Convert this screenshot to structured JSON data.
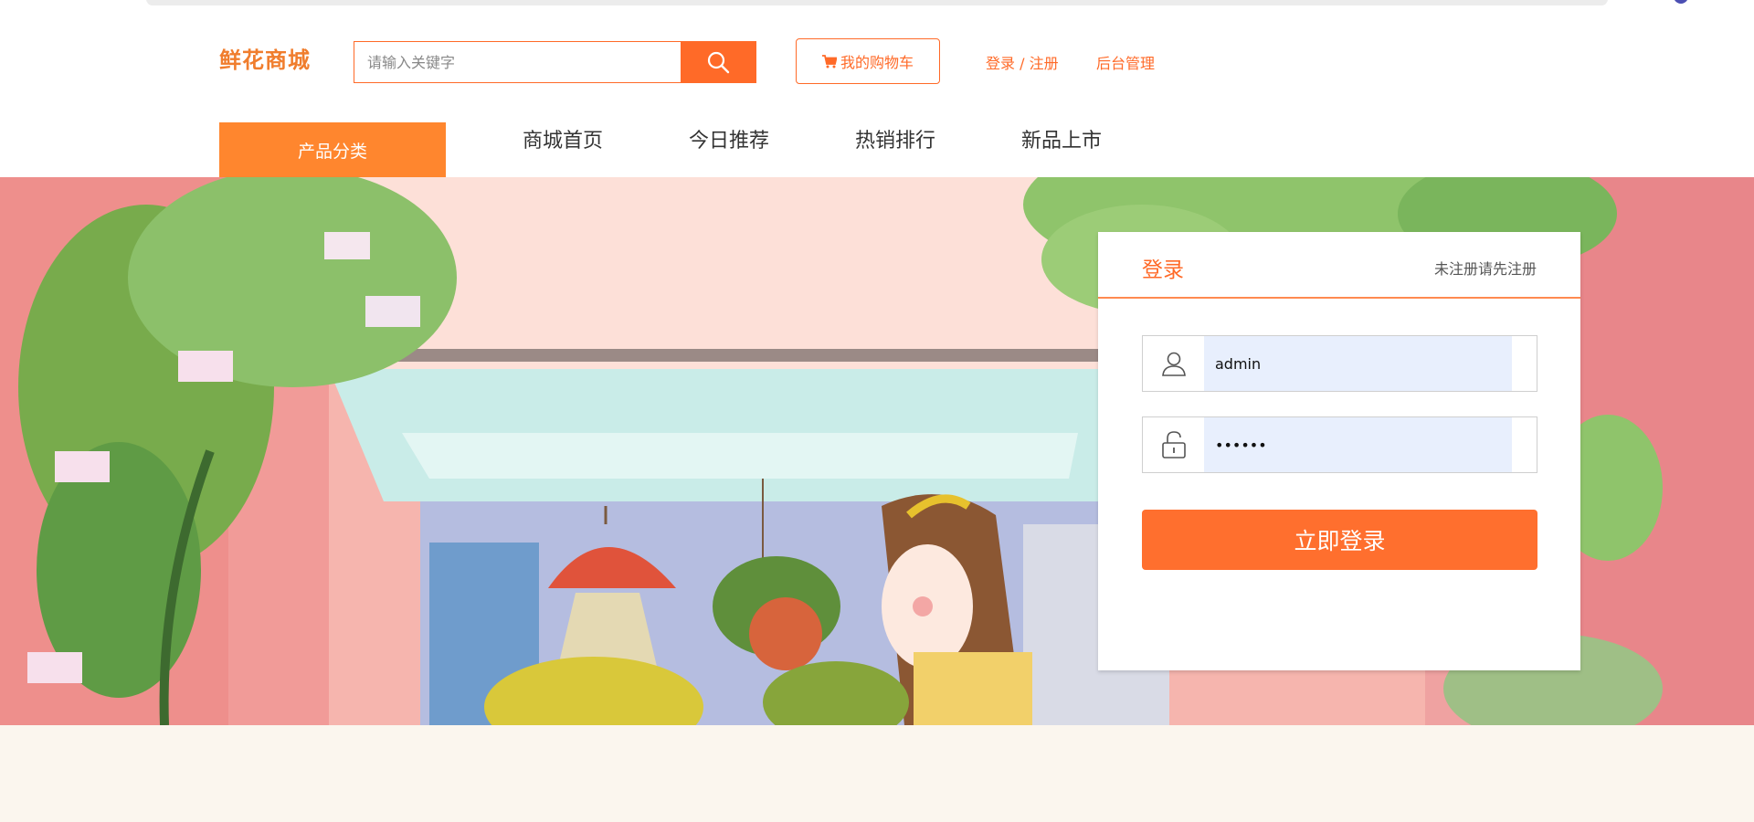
{
  "header": {
    "logo": "鲜花商城",
    "search": {
      "placeholder": "请输入关键字",
      "value": ""
    },
    "cart_label": "我的购物车",
    "login_register": "登录 / 注册",
    "admin": "后台管理"
  },
  "nav": {
    "category": "产品分类",
    "items": [
      {
        "label": "商城首页"
      },
      {
        "label": "今日推荐"
      },
      {
        "label": "热销排行"
      },
      {
        "label": "新品上市"
      }
    ]
  },
  "login": {
    "title": "登录",
    "register_hint": "未注册请先注册",
    "username": "admin",
    "password": "••••••",
    "submit": "立即登录"
  },
  "icons": {
    "search": "search-icon",
    "cart": "cart-icon",
    "user": "user-icon",
    "lock": "lock-icon"
  },
  "colors": {
    "accent": "#ff6a28",
    "nav_category": "#ff862e",
    "banner_pink": "#f3a9a6",
    "page_bg": "#fbf6ee"
  }
}
